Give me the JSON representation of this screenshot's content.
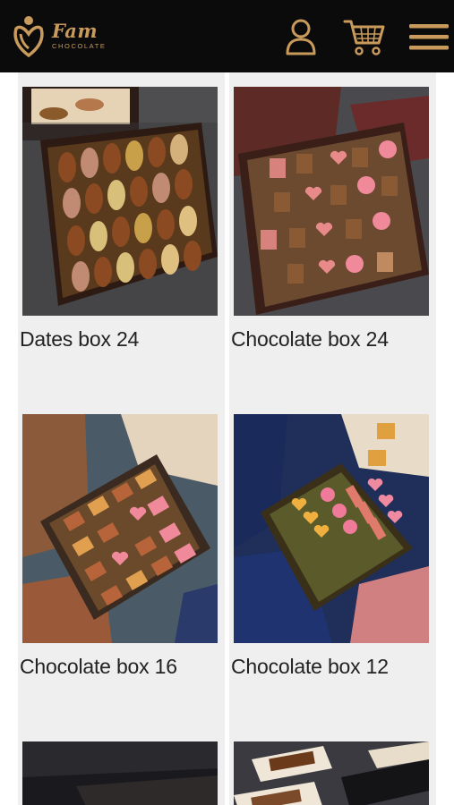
{
  "header": {
    "logo_name": "Fam",
    "logo_sub": "CHOCOLATE",
    "brand_color": "#c89a5b",
    "background": "#0b0b0b",
    "icons": [
      "user-icon",
      "cart-icon",
      "menu-icon"
    ]
  },
  "products": [
    {
      "name": "Dates box 24"
    },
    {
      "name": "Chocolate box 24"
    },
    {
      "name": "Chocolate box 16"
    },
    {
      "name": "Chocolate box 12"
    },
    {
      "name": ""
    },
    {
      "name": ""
    }
  ]
}
